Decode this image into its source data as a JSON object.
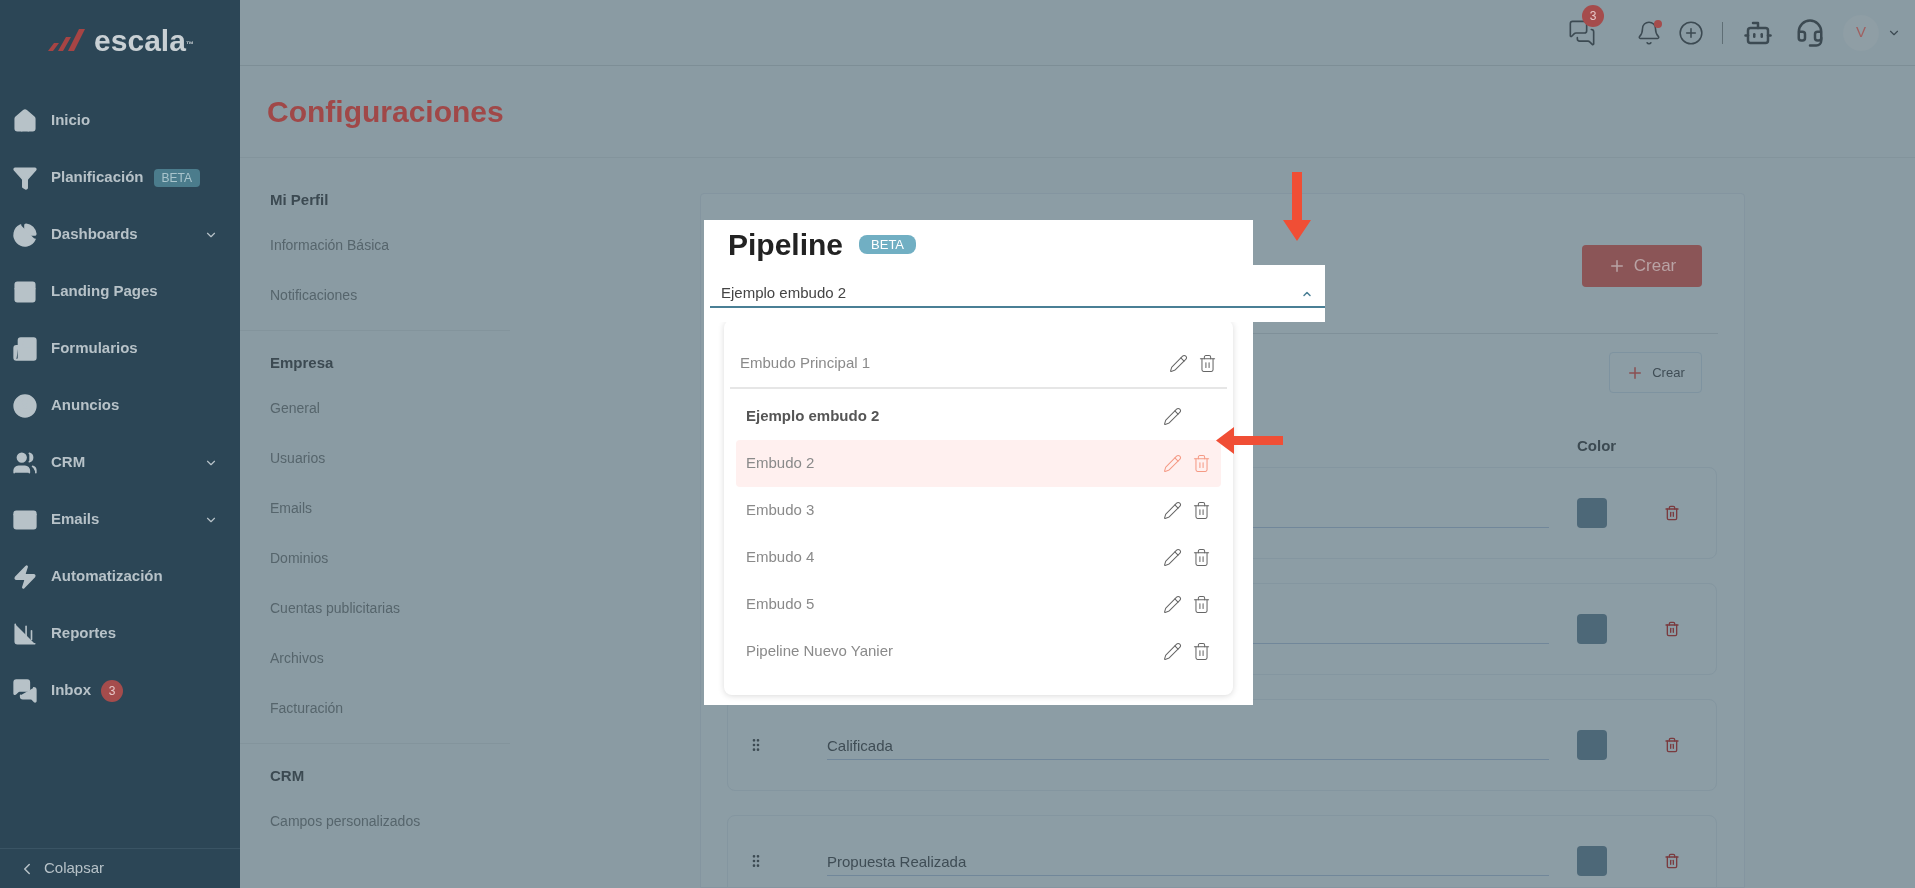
{
  "brand": {
    "name": "escala",
    "mark": "™"
  },
  "sidebar": {
    "items": [
      {
        "label": "Inicio",
        "expandable": false
      },
      {
        "label": "Planificación",
        "expandable": false,
        "badge": {
          "text": "BETA",
          "kind": "tag"
        }
      },
      {
        "label": "Dashboards",
        "expandable": true
      },
      {
        "label": "Landing Pages",
        "expandable": false
      },
      {
        "label": "Formularios",
        "expandable": false
      },
      {
        "label": "Anuncios",
        "expandable": false
      },
      {
        "label": "CRM",
        "expandable": true
      },
      {
        "label": "Emails",
        "expandable": true
      },
      {
        "label": "Automatización",
        "expandable": false
      },
      {
        "label": "Reportes",
        "expandable": false
      },
      {
        "label": "Inbox",
        "expandable": false,
        "badge": {
          "text": "3",
          "kind": "count"
        }
      }
    ],
    "collapse": "Colapsar"
  },
  "topbar": {
    "messages_count": "3",
    "bell_unread": true,
    "avatar": "V"
  },
  "page_title": "Configuraciones",
  "settings_nav": [
    {
      "heading": "Mi Perfil",
      "items": [
        "Información Básica",
        "Notificaciones"
      ]
    },
    {
      "heading": "Empresa",
      "items": [
        "General",
        "Usuarios",
        "Emails",
        "Dominios",
        "Cuentas publicitarias",
        "Archivos",
        "Facturación"
      ]
    },
    {
      "heading": "CRM",
      "items": [
        "Campos personalizados"
      ]
    }
  ],
  "pipeline": {
    "title": "Pipeline",
    "badge": "BETA",
    "value": "Ejemplo embudo 2",
    "expanded": true,
    "groups": [
      [
        {
          "label": "Embudo Principal 1",
          "selected": false,
          "hovered": false,
          "deletable": true
        }
      ],
      [
        {
          "label": "Ejemplo embudo 2",
          "selected": true,
          "hovered": false,
          "deletable": false
        },
        {
          "label": "Embudo 2",
          "selected": false,
          "hovered": true,
          "deletable": true
        },
        {
          "label": "Embudo 3",
          "selected": false,
          "hovered": false,
          "deletable": true
        },
        {
          "label": "Embudo 4",
          "selected": false,
          "hovered": false,
          "deletable": true
        },
        {
          "label": "Embudo 5",
          "selected": false,
          "hovered": false,
          "deletable": true
        },
        {
          "label": "Pipeline Nuevo Yanier",
          "selected": false,
          "hovered": false,
          "deletable": true
        }
      ]
    ]
  },
  "create_pipeline_button": "Crear",
  "create_stage_button": "Crear",
  "stages_header": {
    "title": "Color"
  },
  "stages": [
    {
      "color": "#4d6878"
    },
    {
      "color": "#4d6878"
    },
    {
      "name": "Calificada",
      "color": "#4d6878"
    },
    {
      "name": "Propuesta Realizada",
      "color": "#4d6878"
    }
  ]
}
